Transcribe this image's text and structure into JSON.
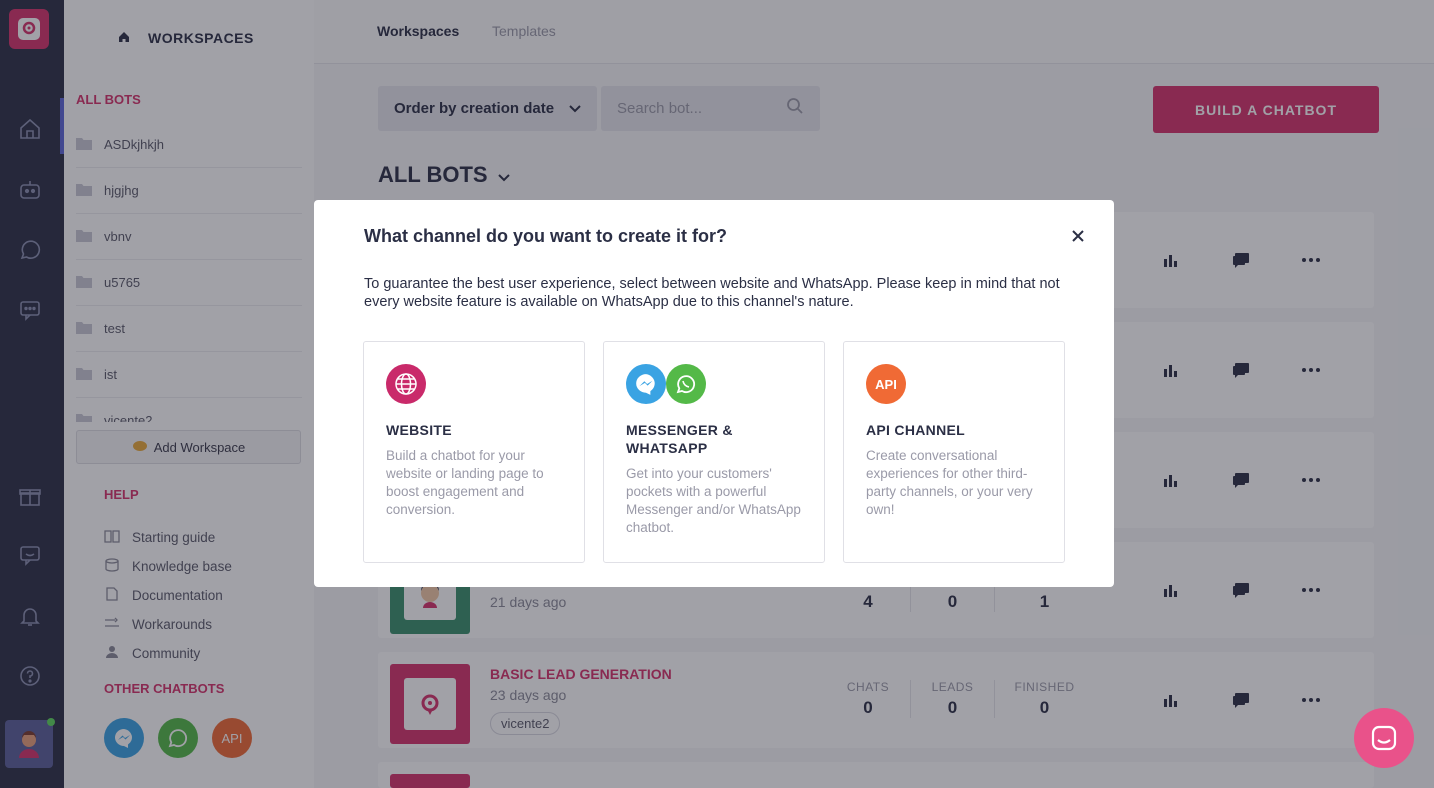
{
  "app": {
    "accent_color": "#d6336c",
    "rail_color": "#2b2f45"
  },
  "rail": {
    "icons": [
      "home-icon",
      "bot-icon",
      "whatsapp-icon",
      "chat-icon",
      "gift-icon",
      "support-chat-icon",
      "bell-icon",
      "help-icon"
    ]
  },
  "sidebar": {
    "header": "WORKSPACES",
    "all_bots": "ALL BOTS",
    "workspaces": [
      "ASDkjhkjh",
      "hjgjhg",
      "vbnv",
      "u5765",
      "test",
      "ist",
      "vicente2"
    ],
    "add_workspace": "Add Workspace",
    "help_title": "HELP",
    "help_items": [
      "Starting guide",
      "Knowledge base",
      "Documentation",
      "Workarounds",
      "Community"
    ],
    "other_title": "OTHER CHATBOTS",
    "other_api_label": "API"
  },
  "topbar": {
    "tabs": [
      "Workspaces",
      "Templates"
    ]
  },
  "toolbar": {
    "order_label": "Order by creation date",
    "search_placeholder": "Search bot...",
    "build_label": "BUILD A CHATBOT"
  },
  "list": {
    "heading": "ALL BOTS",
    "stat_labels": [
      "CHATS",
      "LEADS",
      "FINISHED"
    ],
    "bots": [
      {
        "date": "21 days ago",
        "chats": "4",
        "leads": "0",
        "finished": "1",
        "thumb_color": "#3a8f6c"
      },
      {
        "name": "BASIC LEAD GENERATION",
        "date": "23 days ago",
        "tag": "vicente2",
        "chats": "0",
        "leads": "0",
        "finished": "0",
        "thumb_color": "#d6336c"
      }
    ]
  },
  "modal": {
    "title": "What channel do you want to create it for?",
    "description": "To guarantee the best user experience, select between website and WhatsApp. Please keep in mind that not every website feature is available on WhatsApp due to this channel's nature.",
    "options": [
      {
        "title": "WEBSITE",
        "description": "Build a chatbot for your website or landing page to boost engagement and conversion."
      },
      {
        "title": "MESSENGER & WHATSAPP",
        "description": "Get into your customers' pockets with a powerful Messenger and/or WhatsApp chatbot."
      },
      {
        "title": "API CHANNEL",
        "icon_label": "API",
        "description": "Create conversational experiences for other third-party channels, or your very own!"
      }
    ]
  }
}
